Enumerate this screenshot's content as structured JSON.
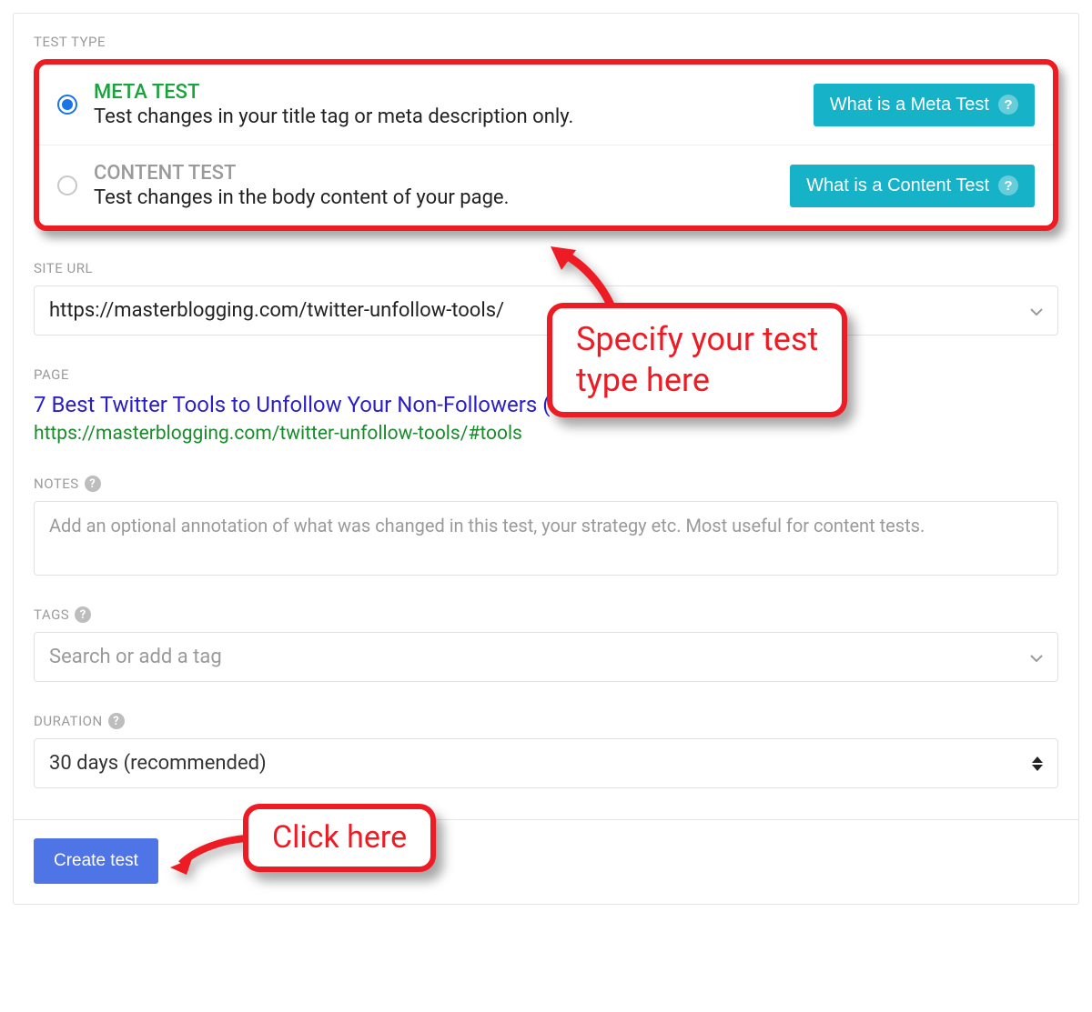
{
  "labels": {
    "test_type": "TEST TYPE",
    "site_url": "SITE URL",
    "page": "PAGE",
    "notes": "NOTES",
    "tags": "TAGS",
    "duration": "DURATION"
  },
  "test_types": {
    "meta": {
      "title": "META TEST",
      "desc": "Test changes in your title tag or meta description only.",
      "info_btn": "What is a Meta Test",
      "selected": true
    },
    "content": {
      "title": "CONTENT TEST",
      "desc": "Test changes in the body content of your page.",
      "info_btn": "What is a Content Test",
      "selected": false
    }
  },
  "site_url": {
    "value": "https://masterblogging.com/twitter-unfollow-tools/"
  },
  "page": {
    "title": "7 Best Twitter Tools to Unfollow Your Non-Followers (",
    "url": "https://masterblogging.com/twitter-unfollow-tools/#tools"
  },
  "notes": {
    "placeholder": "Add an optional annotation of what was changed in this test, your strategy etc. Most useful for content tests."
  },
  "tags": {
    "placeholder": "Search or add a tag"
  },
  "duration": {
    "value": "30 days (recommended)"
  },
  "buttons": {
    "create": "Create test"
  },
  "annotations": {
    "specify": "Specify your test\ntype here",
    "click": "Click here"
  }
}
